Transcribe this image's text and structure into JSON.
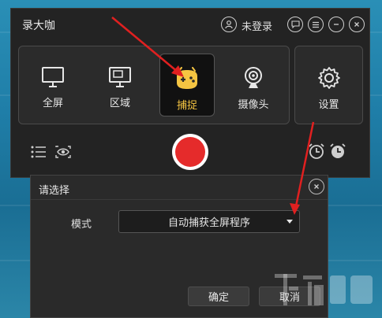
{
  "app": {
    "title": "录大咖",
    "login_text": "未登录",
    "modes": [
      {
        "label": "全屏",
        "icon": "monitor-icon"
      },
      {
        "label": "区域",
        "icon": "region-icon"
      },
      {
        "label": "捕捉",
        "icon": "gamepad-icon",
        "active": true
      },
      {
        "label": "摄像头",
        "icon": "webcam-icon"
      }
    ],
    "settings_label": "设置",
    "record_color": "#e52b2b",
    "active_color": "#f5c542"
  },
  "dialog": {
    "title": "请选择",
    "mode_label": "模式",
    "mode_value": "自动捕获全屏程序",
    "ok_label": "确定",
    "cancel_label": "取消"
  },
  "annotation_color": "#e02020"
}
